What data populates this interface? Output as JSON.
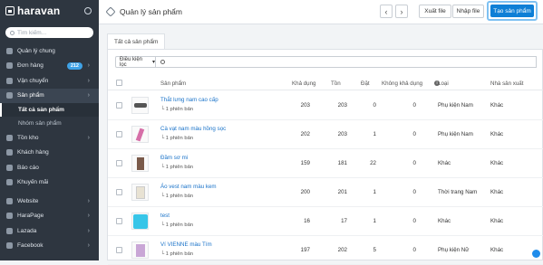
{
  "sidebar": {
    "brand": "haravan",
    "search_placeholder": "Tìm kiếm...",
    "items": [
      {
        "label": "Quản lý chung"
      },
      {
        "label": "Đơn hàng",
        "badge": "212",
        "chevron": "›"
      },
      {
        "label": "Vận chuyển",
        "chevron": "›"
      },
      {
        "label": "Sản phẩm",
        "chevron": "›"
      },
      {
        "label": "Tồn kho",
        "chevron": "›"
      },
      {
        "label": "Khách hàng"
      },
      {
        "label": "Báo cáo"
      },
      {
        "label": "Khuyến mãi"
      }
    ],
    "sub_items": [
      {
        "label": "Tất cả sản phẩm"
      },
      {
        "label": "Nhóm sản phẩm"
      }
    ],
    "bottom_items": [
      {
        "label": "Website",
        "chevron": "›"
      },
      {
        "label": "HaraPage",
        "chevron": "›"
      },
      {
        "label": "Lazada",
        "chevron": "›"
      },
      {
        "label": "Facebook",
        "chevron": "›"
      }
    ]
  },
  "header": {
    "title": "Quản lý sản phẩm",
    "prev": "‹",
    "next": "›",
    "export_label": "Xuất file",
    "import_label": "Nhập file",
    "create_label": "Tạo sản phẩm"
  },
  "tabs": [
    {
      "label": "Tất cả sản phẩm"
    }
  ],
  "filter": {
    "label": "Điều kiện lọc",
    "caret": "▾"
  },
  "table": {
    "columns": [
      "Sản phẩm",
      "Khả dụng",
      "Tồn",
      "Đặt",
      "Không khả dụng",
      "Loại",
      "Nhà sản xuất"
    ],
    "info_icon": "i",
    "rows": [
      {
        "name": "Thắt lưng nam cao cấp",
        "variants": "└ 1 phiên bản",
        "available": "203",
        "stock": "203",
        "ordered": "0",
        "unavailable": "0",
        "type": "Phụ kiện Nam",
        "vendor": "Khác"
      },
      {
        "name": "Cà vạt nam màu hồng sọc",
        "variants": "└ 1 phiên bản",
        "available": "202",
        "stock": "203",
        "ordered": "1",
        "unavailable": "0",
        "type": "Phụ kiện Nam",
        "vendor": "Khác"
      },
      {
        "name": "Đầm sơ mi",
        "variants": "└ 1 phiên bản",
        "available": "159",
        "stock": "181",
        "ordered": "22",
        "unavailable": "0",
        "type": "Khác",
        "vendor": "Khác"
      },
      {
        "name": "Áo vest nam màu kem",
        "variants": "└ 1 phiên bản",
        "available": "200",
        "stock": "201",
        "ordered": "1",
        "unavailable": "0",
        "type": "Thời trang Nam",
        "vendor": "Khác"
      },
      {
        "name": "test",
        "variants": "└ 1 phiên bản",
        "available": "16",
        "stock": "17",
        "ordered": "1",
        "unavailable": "0",
        "type": "Khác",
        "vendor": "Khác"
      },
      {
        "name": "Ví VIENNE màu Tím",
        "variants": "└ 1 phiên bản",
        "available": "197",
        "stock": "202",
        "ordered": "5",
        "unavailable": "0",
        "type": "Phụ kiện Nữ",
        "vendor": "Khác"
      }
    ]
  },
  "colors": {
    "primary": "#0e7fd6",
    "sidebar": "#2e3640",
    "link": "#1a73c9"
  }
}
